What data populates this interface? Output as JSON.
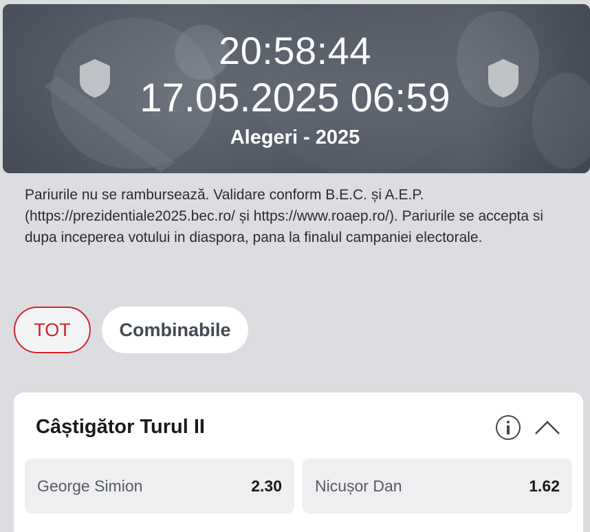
{
  "header": {
    "countdown": "20:58:44",
    "event_datetime": "17.05.2025 06:59",
    "event_name": "Alegeri - 2025"
  },
  "notice": "Pariurile nu se rambursează. Validare conform B.E.C. și A.E.P. (https://prezidentiale2025.bec.ro/ și https://www.roaep.ro/). Pariurile se accepta si dupa inceperea votului in diaspora, pana la finalul campaniei electorale.",
  "filters": {
    "all_label": "TOT",
    "combinable_label": "Combinabile"
  },
  "market": {
    "title": "Câștigător Turul II",
    "outcomes": [
      {
        "name": "George Simion",
        "odds": "2.30"
      },
      {
        "name": "Nicușor Dan",
        "odds": "1.62"
      }
    ]
  },
  "colors": {
    "accent": "#d1232a",
    "page_bg": "#dcdde0",
    "card_bg": "#ffffff",
    "odd_bg": "#efeff1"
  },
  "icons": [
    "team-shield-icon",
    "info-icon",
    "chevron-up-icon"
  ]
}
